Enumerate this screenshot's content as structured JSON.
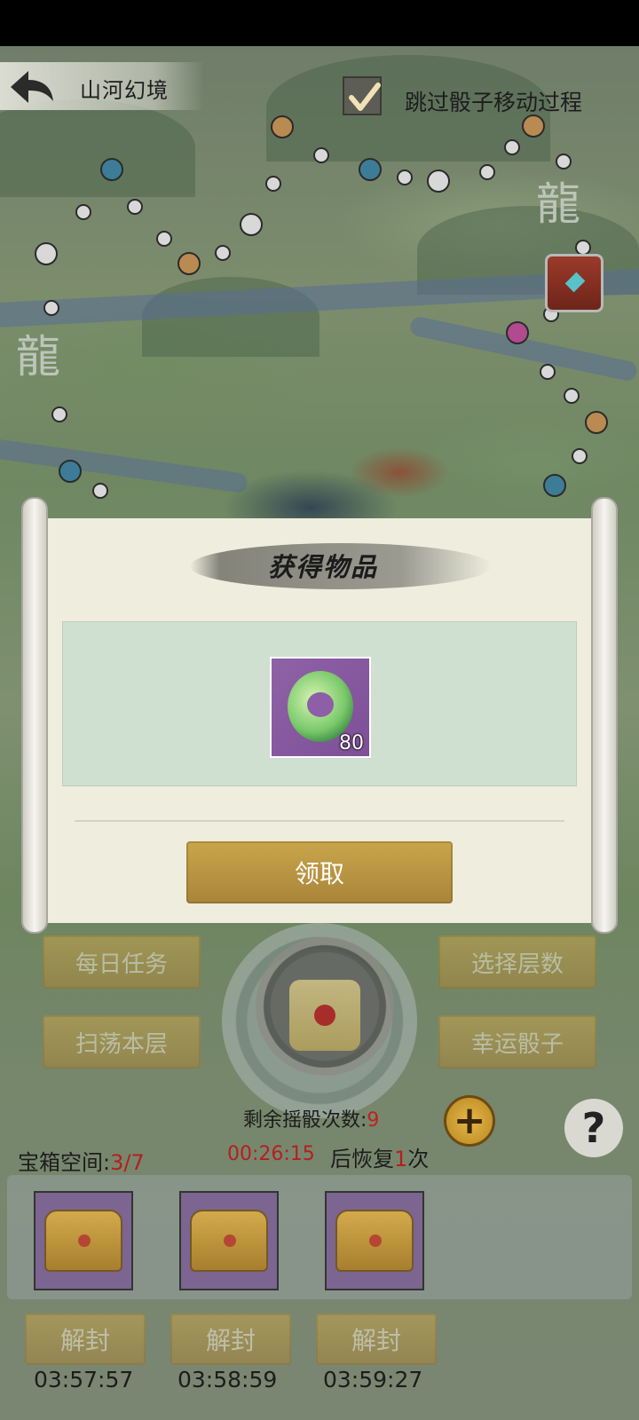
{
  "header": {
    "title": "山河幻境",
    "skip_label": "跳过骰子移动过程",
    "skip_checked": true
  },
  "map": {
    "dragon_glyph": "龍"
  },
  "dialog": {
    "title": "获得物品",
    "item": {
      "count": "80",
      "icon": "jade-ring-icon"
    },
    "claim_label": "领取"
  },
  "controls": {
    "daily_tasks": "每日任务",
    "sweep_floor": "扫荡本层",
    "select_floor": "选择层数",
    "lucky_dice": "幸运骰子",
    "remaining_label": "剩余摇骰次数:",
    "remaining_count": "9",
    "plus": "+",
    "help": "?"
  },
  "chests": {
    "space_label": "宝箱空间:",
    "space_value": "3/7",
    "timer": "00:26:15",
    "recover_prefix": "后恢复",
    "recover_count": "1",
    "recover_suffix": "次",
    "slots": [
      {
        "unseal_label": "解封",
        "countdown": "03:57:57"
      },
      {
        "unseal_label": "解封",
        "countdown": "03:58:59"
      },
      {
        "unseal_label": "解封",
        "countdown": "03:59:27"
      }
    ]
  },
  "colors": {
    "gold_button": "#c9a64b",
    "accent_red": "#b51f1f",
    "item_bg": "#8f62a8",
    "dialog_bg": "#eeedde"
  }
}
